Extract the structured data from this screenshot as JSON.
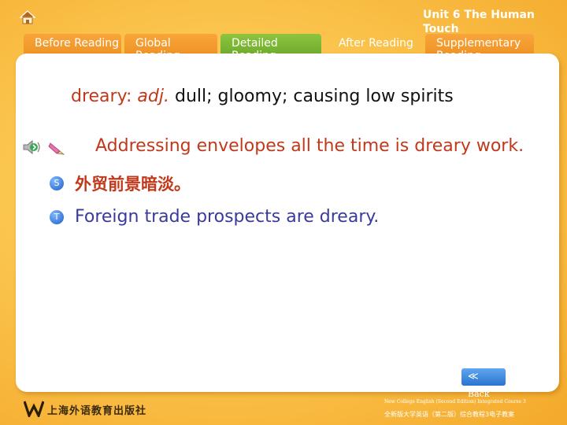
{
  "header": {
    "unit_title": "Unit 6 The Human Touch",
    "tabs": [
      {
        "label": "Before Reading"
      },
      {
        "label": "Global Reading"
      },
      {
        "label": "Detailed Reading"
      },
      {
        "label": "After Reading"
      },
      {
        "label": "Supplementary Reading"
      }
    ],
    "active_tab": "Detailed Reading"
  },
  "entry": {
    "word": "dreary:",
    "pos": "adj.",
    "meaning": "dull; gloomy; causing low spirits"
  },
  "example": {
    "english": "Addressing envelopes all the time is dreary work.",
    "s_badge": "S",
    "chinese": "外贸前景暗淡。",
    "t_badge": "T",
    "translation": "Foreign trade prospects are dreary."
  },
  "controls": {
    "back_label": "Back",
    "back_chevron": "≪"
  },
  "footer": {
    "publisher": "上海外语教育出版社",
    "line1": "New College English (Second Edition) Integrated Course 3",
    "line2": "全新版大学英语（第二版）综合教程3电子教案"
  },
  "colors": {
    "background": "#fbc650",
    "tab": "#ee8f22",
    "active_tab": "#7ab536",
    "accent_red": "#c0391b",
    "translation_blue": "#3a3a9a",
    "button_blue": "#2b73cf"
  },
  "icons": [
    "home-icon",
    "speaker-icon",
    "pencil-icon",
    "back-icon",
    "publisher-logo"
  ]
}
